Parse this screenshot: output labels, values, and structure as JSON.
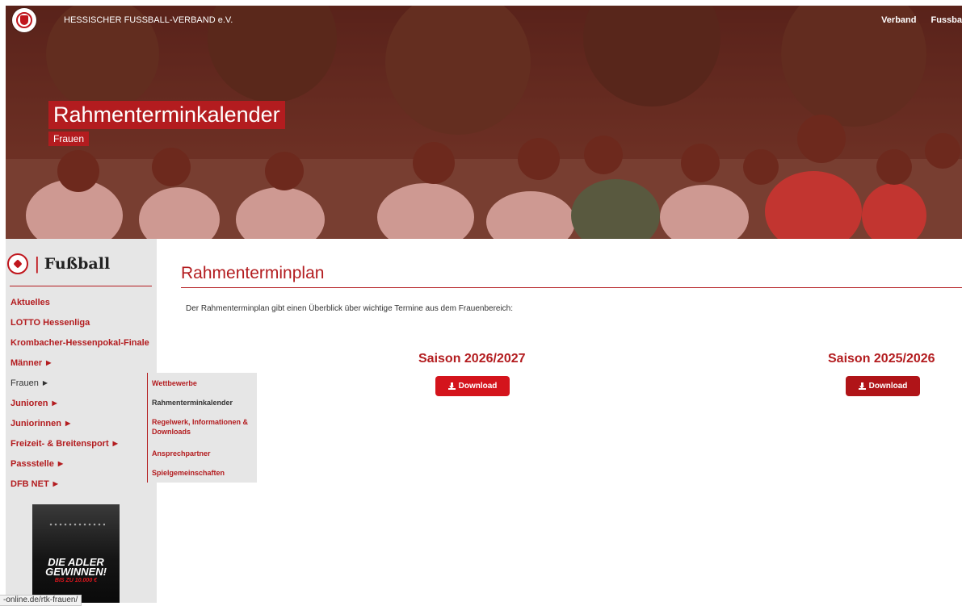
{
  "header": {
    "org_name": "HESSISCHER FUSSBALL-VERBAND e.V.",
    "nav": [
      "Verband",
      "Fussba"
    ]
  },
  "hero": {
    "title": "Rahmenterminkalender",
    "subtitle": "Frauen"
  },
  "sidebar": {
    "brand": "Fußball",
    "items": [
      {
        "label": "Aktuelles",
        "has_caret": false
      },
      {
        "label": "LOTTO Hessenliga",
        "has_caret": false
      },
      {
        "label": "Krombacher-Hessenpokal-Finale",
        "has_caret": false
      },
      {
        "label": "Männer",
        "has_caret": true
      },
      {
        "label": "Frauen",
        "has_caret": true,
        "active": true
      },
      {
        "label": "Junioren",
        "has_caret": true
      },
      {
        "label": "Juniorinnen",
        "has_caret": true
      },
      {
        "label": "Freizeit- & Breitensport",
        "has_caret": true
      },
      {
        "label": "Passstelle",
        "has_caret": true
      },
      {
        "label": "DFB NET",
        "has_caret": true
      }
    ],
    "submenu": [
      "Wettbewerbe",
      "Rahmenterminkalender",
      "Regelwerk, Informationen & Downloads",
      "Ansprechpartner",
      "Spielgemeinschaften"
    ],
    "ad": {
      "line1": "DIE ADLER",
      "line2": "GEWINNEN!",
      "line3": "BIS ZU 10.000 €"
    }
  },
  "main": {
    "title": "Rahmenterminplan",
    "intro": "Der Rahmenterminplan gibt einen Überblick über wichtige Termine aus dem Frauenbereich:",
    "seasons": [
      {
        "label": "Saison 2026/2027",
        "button": "Download",
        "color": "#d4141c"
      },
      {
        "label": "Saison 2025/2026",
        "button": "Download",
        "color": "#b01418"
      }
    ]
  },
  "status_bar": {
    "url": "-online.de/rtk-frauen/"
  },
  "colors": {
    "brand_red": "#b31c1f",
    "sidebar_bg": "#e6e6e6"
  }
}
